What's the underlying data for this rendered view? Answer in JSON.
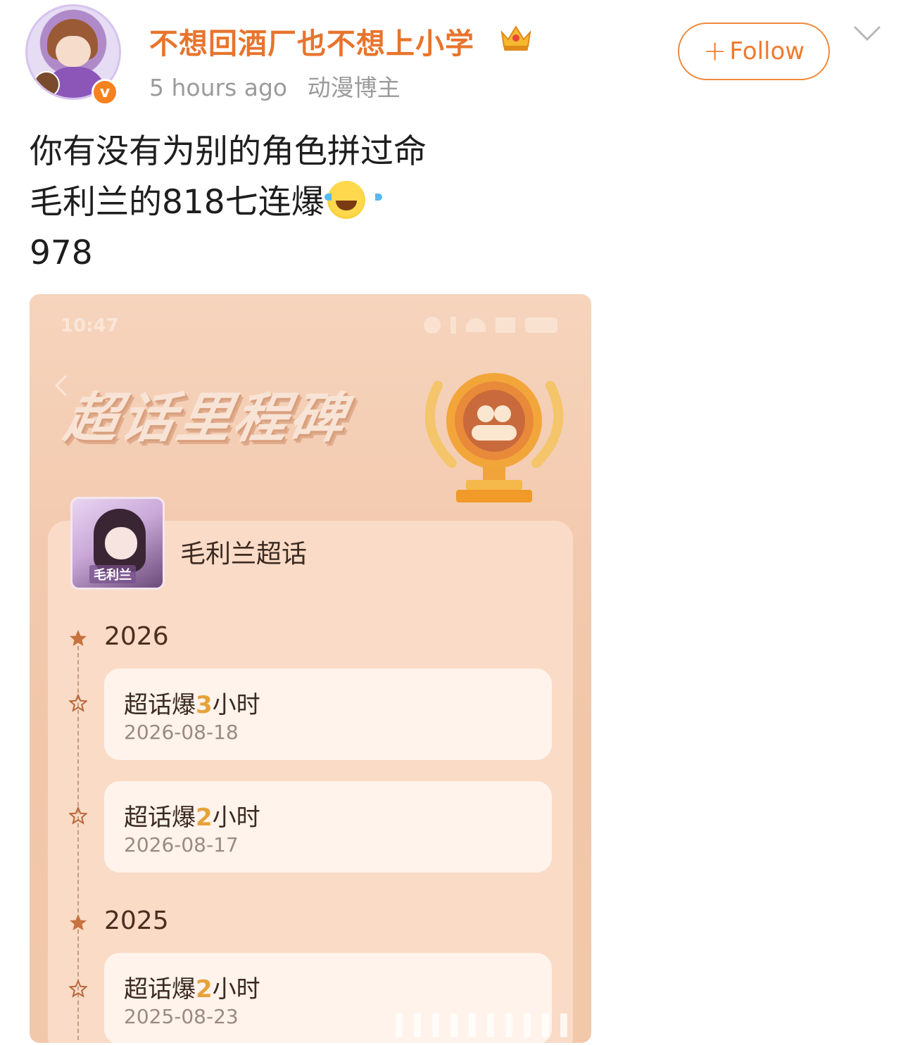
{
  "header": {
    "username": "不想回酒厂也不想上小学",
    "timestamp": "5 hours ago",
    "user_tag": "动漫博主",
    "follow_label": "Follow",
    "verified_mark": "v"
  },
  "post": {
    "lines": [
      "你有没有为别的角色拼过命",
      "毛利兰的818七连爆",
      "978"
    ]
  },
  "screenshot": {
    "status_time": "10:47",
    "banner_title": "超话里程碑",
    "topic_name": "毛利兰超话",
    "topic_avatar_label": "毛利兰",
    "sections": [
      {
        "year": "2026",
        "items": [
          {
            "prefix": "超话爆",
            "num": "3",
            "suffix": "小时",
            "date": "2026-08-18"
          },
          {
            "prefix": "超话爆",
            "num": "2",
            "suffix": "小时",
            "date": "2026-08-17"
          }
        ]
      },
      {
        "year": "2025",
        "items": [
          {
            "prefix": "超话爆",
            "num": "2",
            "suffix": "小时",
            "date": "2025-08-23"
          }
        ]
      }
    ]
  },
  "colors": {
    "accent": "#e8742d",
    "follow_border": "#ef8a3e",
    "highlight_num": "#e6a23a"
  }
}
